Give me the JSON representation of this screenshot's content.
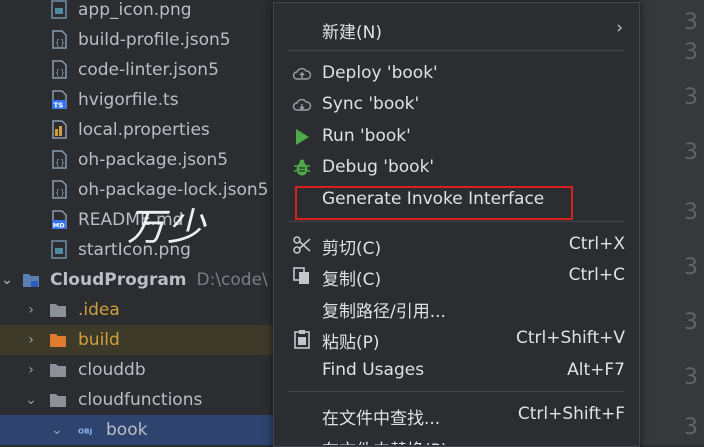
{
  "tree": {
    "rows": [
      {
        "label": "app_icon.png",
        "icon": "image-file-icon"
      },
      {
        "label": "build-profile.json5",
        "icon": "json-file-icon"
      },
      {
        "label": "code-linter.json5",
        "icon": "json-file-icon"
      },
      {
        "label": "hvigorfile.ts",
        "icon": "ts-file-icon"
      },
      {
        "label": "local.properties",
        "icon": "properties-file-icon"
      },
      {
        "label": "oh-package.json5",
        "icon": "json-file-icon"
      },
      {
        "label": "oh-package-lock.json5",
        "icon": "json-file-icon"
      },
      {
        "label": "README.md",
        "icon": "md-file-icon"
      },
      {
        "label": "startIcon.png",
        "icon": "image-file-icon"
      },
      {
        "label": "CloudProgram",
        "path": "D:\\code\\",
        "icon": "module-folder-icon"
      },
      {
        "label": ".idea",
        "icon": "folder-icon"
      },
      {
        "label": "build",
        "icon": "folder-orange-icon"
      },
      {
        "label": "clouddb",
        "icon": "folder-icon"
      },
      {
        "label": "cloudfunctions",
        "icon": "folder-icon"
      },
      {
        "label": "book",
        "icon": "obj-folder-icon"
      }
    ]
  },
  "editor": {
    "line_number": "3"
  },
  "menu": {
    "new": {
      "label": "新建(N)"
    },
    "deploy": {
      "label": "Deploy 'book'"
    },
    "sync": {
      "label": "Sync 'book'"
    },
    "run": {
      "label": "Run 'book'"
    },
    "debug": {
      "label": "Debug 'book'"
    },
    "generate": {
      "label": "Generate Invoke Interface"
    },
    "cut": {
      "label": "剪切(C)",
      "shortcut": "Ctrl+X"
    },
    "copy": {
      "label": "复制(C)",
      "shortcut": "Ctrl+C"
    },
    "copy_path": {
      "label": "复制路径/引用..."
    },
    "paste": {
      "label": "粘贴(P)",
      "shortcut": "Ctrl+Shift+V"
    },
    "find_usages": {
      "label": "Find Usages",
      "shortcut": "Alt+F7"
    },
    "find_in_files": {
      "label": "在文件中查找...",
      "shortcut": "Ctrl+Shift+F"
    },
    "replace_in_files": {
      "label": "在文件中替换(P)..."
    }
  },
  "overlay": {
    "handwriting": "万少"
  },
  "colors": {
    "highlight_box": "#d9201f",
    "run_green": "#4fa849",
    "selection": "#2e436e"
  }
}
